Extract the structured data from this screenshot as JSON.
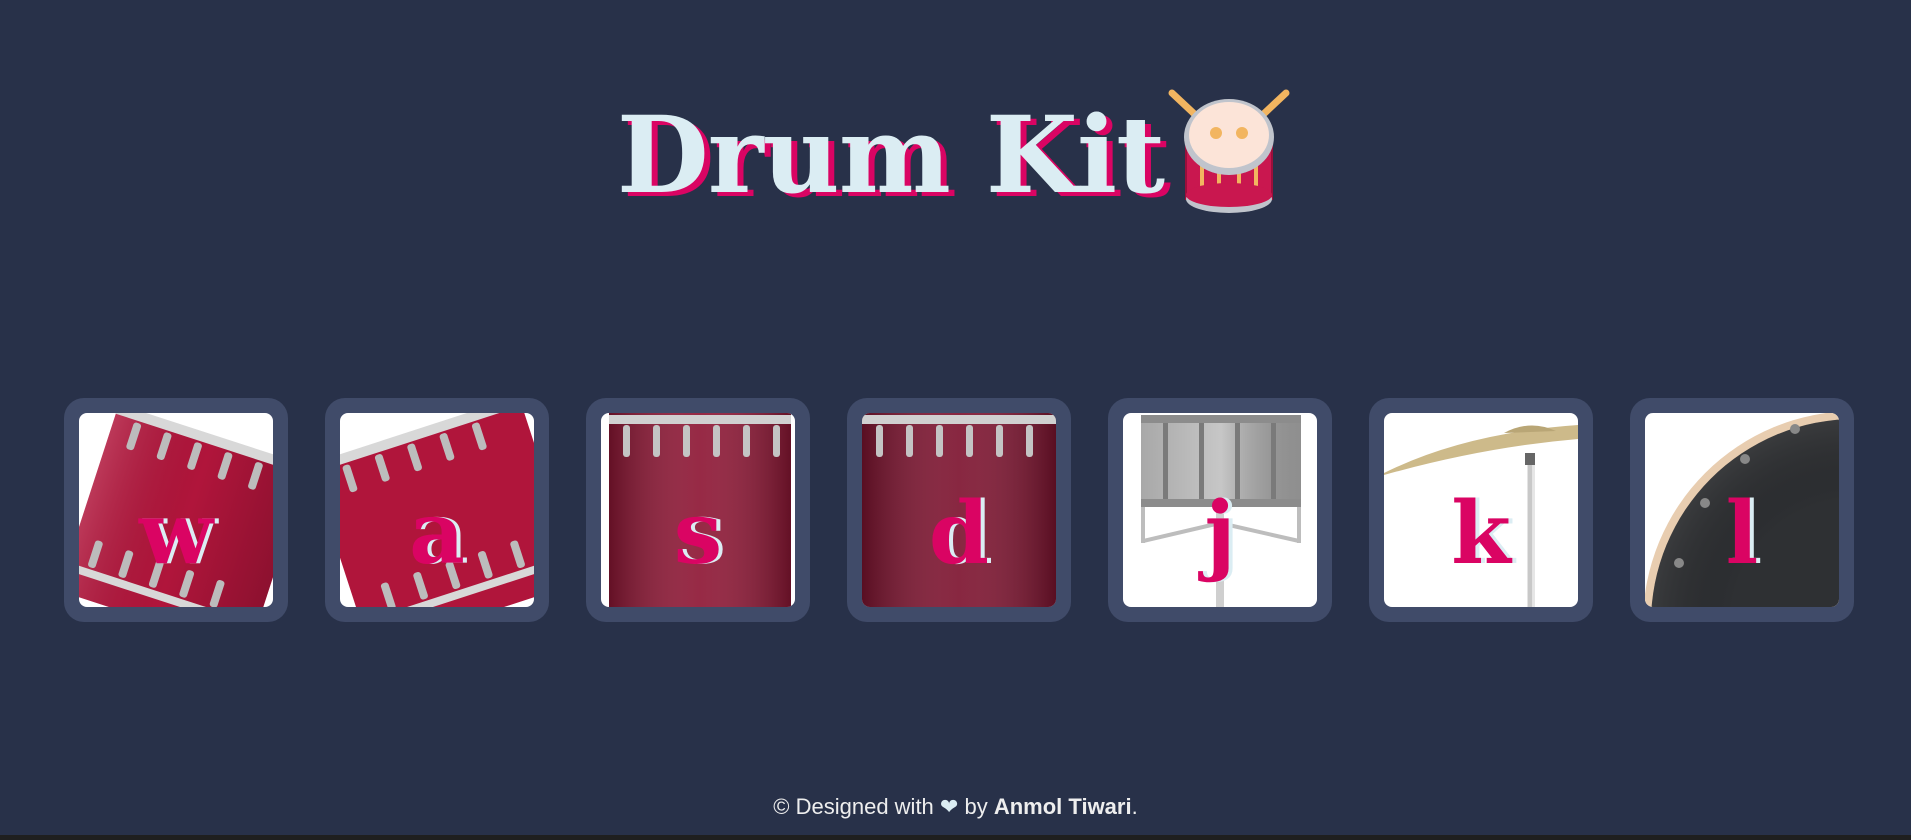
{
  "header": {
    "title": "Drum Kit",
    "emoji_icon": "drum-icon"
  },
  "pads": [
    {
      "key": "w",
      "image": "tom-tilted-icon"
    },
    {
      "key": "a",
      "image": "tom-tilted-icon"
    },
    {
      "key": "s",
      "image": "floor-tom-icon"
    },
    {
      "key": "d",
      "image": "floor-tom-icon"
    },
    {
      "key": "j",
      "image": "snare-icon"
    },
    {
      "key": "k",
      "image": "cymbal-icon"
    },
    {
      "key": "l",
      "image": "bass-drum-icon"
    }
  ],
  "footer": {
    "prefix": "© Designed with",
    "heart_icon": "heart-icon",
    "by": "by",
    "author": "Anmol Tiwari",
    "suffix": "."
  },
  "colors": {
    "background": "#283149",
    "pad_frame": "#404B69",
    "accent": "#DA0463",
    "title_text": "#DBEDF3"
  }
}
